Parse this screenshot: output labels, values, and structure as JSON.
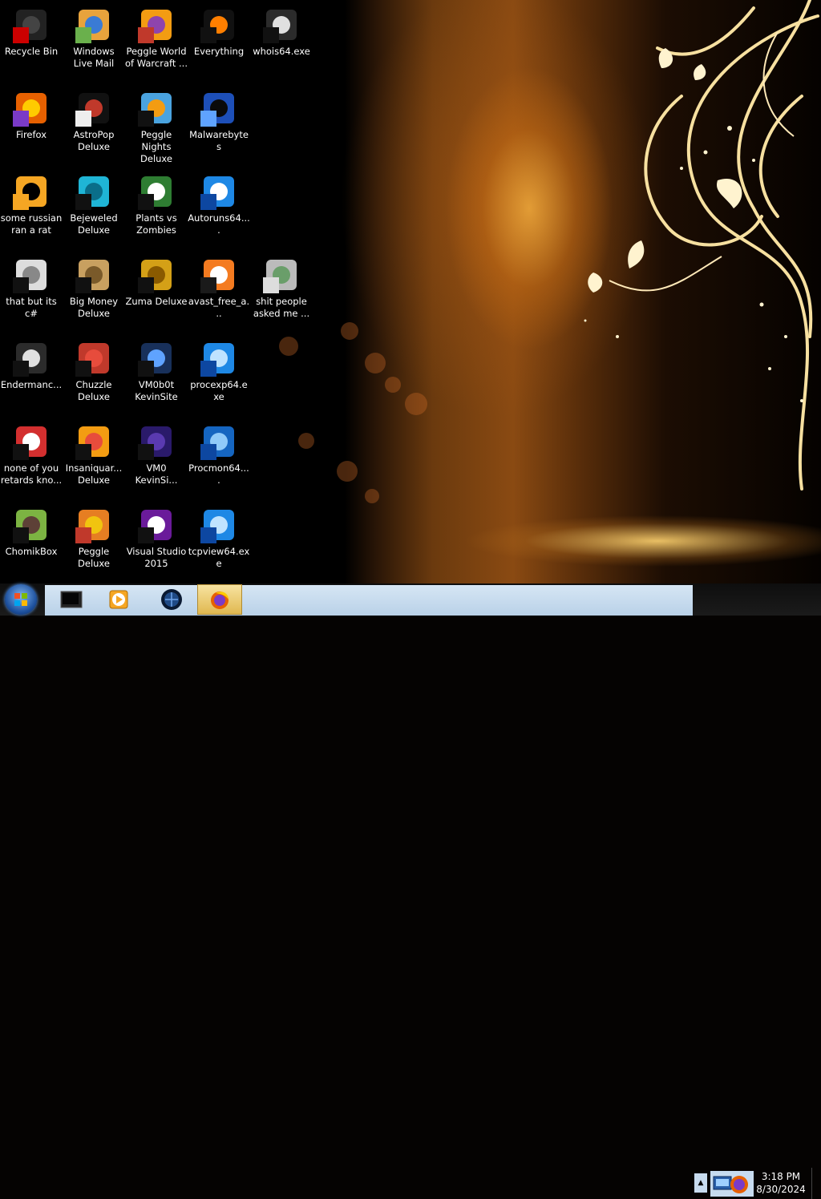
{
  "desktop": {
    "icons": [
      {
        "label": "Recycle Bin",
        "icon": "recycle-bin-icon"
      },
      {
        "label": "Windows Live Mail",
        "icon": "windows-live-mail-icon"
      },
      {
        "label": "Peggle World of Warcraft ...",
        "icon": "peggle-wow-icon"
      },
      {
        "label": "Everything",
        "icon": "everything-search-icon"
      },
      {
        "label": "whois64.exe",
        "icon": "console-app-icon"
      },
      {
        "label": "Firefox",
        "icon": "firefox-icon"
      },
      {
        "label": "AstroPop Deluxe",
        "icon": "astropop-icon"
      },
      {
        "label": "Peggle Nights Deluxe",
        "icon": "peggle-nights-icon"
      },
      {
        "label": "Malwarebytes",
        "icon": "malwarebytes-icon"
      },
      {
        "label": "some russian ran a rat",
        "icon": "russian-rat-icon"
      },
      {
        "label": "Bejeweled Deluxe",
        "icon": "bejeweled-icon"
      },
      {
        "label": "Plants vs Zombies",
        "icon": "plants-vs-zombies-icon"
      },
      {
        "label": "Autoruns64....",
        "icon": "autoruns-icon"
      },
      {
        "label": "that but its c#",
        "icon": "shortcut-icon"
      },
      {
        "label": "Big Money Deluxe",
        "icon": "big-money-icon"
      },
      {
        "label": "Zuma Deluxe",
        "icon": "zuma-icon"
      },
      {
        "label": "avast_free_a...",
        "icon": "avast-icon"
      },
      {
        "label": "shit people asked me ...",
        "icon": "folder-icon"
      },
      {
        "label": "Endermanc...",
        "icon": "console-app-icon"
      },
      {
        "label": "Chuzzle Deluxe",
        "icon": "chuzzle-icon"
      },
      {
        "label": "VM0b0t KevinSite",
        "icon": "vmobot-icon"
      },
      {
        "label": "procexp64.exe",
        "icon": "process-explorer-icon"
      },
      {
        "label": "none of you retards kno...",
        "icon": "chrome-like-icon"
      },
      {
        "label": "Insaniquar... Deluxe",
        "icon": "insaniquarium-icon"
      },
      {
        "label": "VM0 KevinSi...",
        "icon": "vm0-icon"
      },
      {
        "label": "Procmon64....",
        "icon": "process-monitor-icon"
      },
      {
        "label": "ChomikBox",
        "icon": "chomikbox-icon"
      },
      {
        "label": "Peggle Deluxe",
        "icon": "peggle-icon"
      },
      {
        "label": "Visual Studio 2015",
        "icon": "visual-studio-icon"
      },
      {
        "label": "tcpview64.exe",
        "icon": "tcpview-icon"
      }
    ]
  },
  "taskbar": {
    "start": {
      "icon": "windows-start-orb-icon"
    },
    "pinned": [
      {
        "icon": "console-taskbar-icon",
        "active": false
      },
      {
        "icon": "media-player-icon",
        "active": false
      },
      {
        "icon": "globe-app-icon",
        "active": false
      },
      {
        "icon": "firefox-taskbar-icon",
        "active": true
      }
    ],
    "tray": {
      "chevron": "▲",
      "icon": "tray-app-icon"
    },
    "clock": {
      "time": "3:18 PM",
      "date": "8/30/2024"
    }
  },
  "colors": {
    "taskbar_glass": "#c7dbef",
    "active_task": "#e8c66a"
  }
}
